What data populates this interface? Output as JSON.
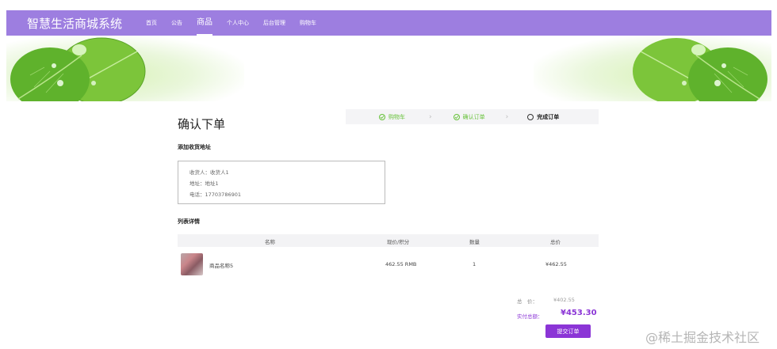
{
  "header": {
    "brand": "智慧生活商城系统",
    "nav": [
      "首页",
      "公告",
      "商品",
      "个人中心",
      "后台管理",
      "购物车"
    ],
    "active_index": 2,
    "bg_color": "#9d7ee0"
  },
  "main": {
    "title": "确认下单",
    "steps": [
      {
        "label": "购物车",
        "state": "done"
      },
      {
        "label": "确认订单",
        "state": "done"
      },
      {
        "label": "完成订单",
        "state": "current"
      }
    ],
    "address_section_label": "添加收货地址",
    "address": {
      "name_line": "收货人：收货人1",
      "addr_line": "地址：地址1",
      "phone_line": "电话：17703786901"
    },
    "list_section_label": "列表详情",
    "table": {
      "headers": [
        "名称",
        "现价/积分",
        "数量",
        "总价"
      ],
      "rows": [
        {
          "name": "商品名称5",
          "price": "462.55 RMB",
          "qty": "1",
          "total": "¥462.55",
          "thumb_icon": "product-thumbnail"
        }
      ]
    },
    "summary": {
      "total_label": "总　价：",
      "total_value": "¥402.55",
      "pay_label": "实付总额：",
      "pay_value": "¥453.30"
    },
    "submit_label": "提交订单"
  },
  "watermark": "@稀土掘金技术社区",
  "colors": {
    "accent": "#8b35d6",
    "step_done": "#67c23a"
  }
}
